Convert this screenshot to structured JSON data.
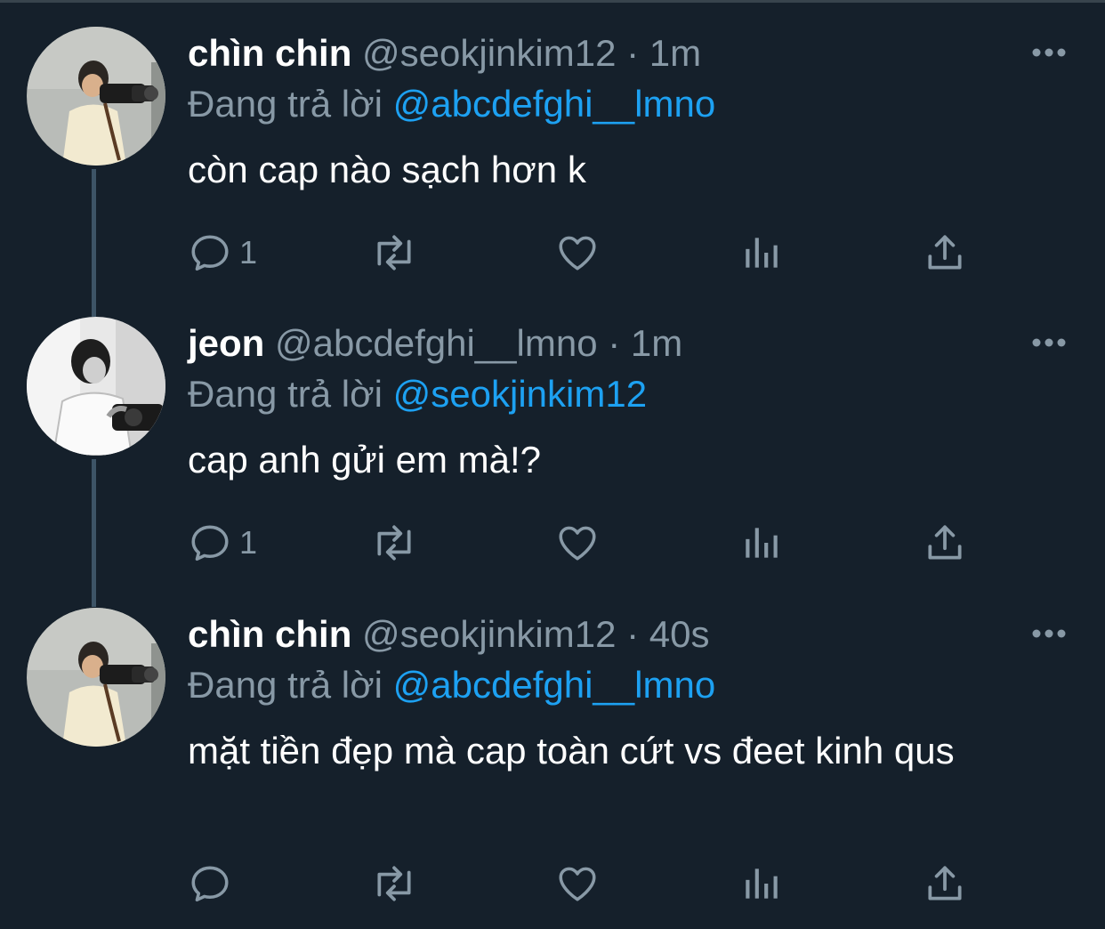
{
  "tweets": [
    {
      "display_name": "chìn chin",
      "handle": "@seokjinkim12",
      "separator": "·",
      "time": "1m",
      "replying_prefix": "Đang trả lời",
      "replying_to": "@abcdefghi__lmno",
      "text": "còn cap nào sạch hơn k",
      "reply_count": "1",
      "avatar_style": "color",
      "icons": [
        "reply-icon",
        "retweet-icon",
        "like-icon",
        "analytics-icon",
        "share-icon",
        "more-icon"
      ]
    },
    {
      "display_name": "jeon",
      "handle": "@abcdefghi__lmno",
      "separator": "·",
      "time": "1m",
      "replying_prefix": "Đang trả lời",
      "replying_to": "@seokjinkim12",
      "text": "cap anh gửi em mà!?",
      "reply_count": "1",
      "avatar_style": "monochrome",
      "icons": [
        "reply-icon",
        "retweet-icon",
        "like-icon",
        "analytics-icon",
        "share-icon",
        "more-icon"
      ]
    },
    {
      "display_name": "chìn chin",
      "handle": "@seokjinkim12",
      "separator": "·",
      "time": "40s",
      "replying_prefix": "Đang trả lời",
      "replying_to": "@abcdefghi__lmno",
      "text": "mặt tiền đẹp mà cap toàn cứt vs đeet kinh qus",
      "reply_count": "",
      "avatar_style": "color",
      "icons": [
        "reply-icon",
        "retweet-icon",
        "like-icon",
        "analytics-icon",
        "share-icon",
        "more-icon"
      ]
    }
  ],
  "colors": {
    "background": "#15202b",
    "primary_text": "#ffffff",
    "secondary_text": "#8899a6",
    "link": "#1da1f2",
    "thread_line": "#3d5466"
  }
}
